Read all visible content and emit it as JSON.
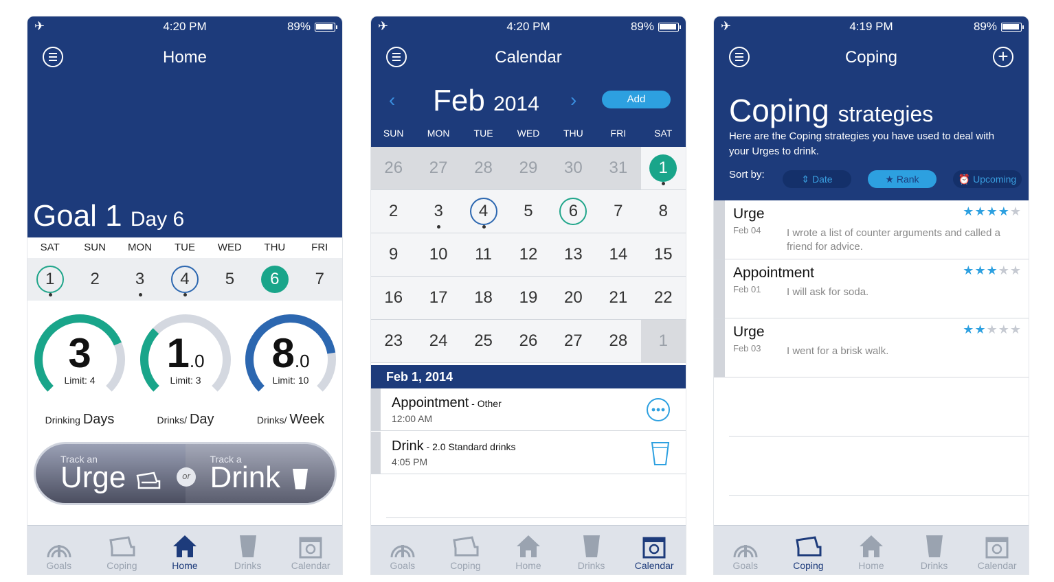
{
  "status": [
    {
      "time": "4:20 PM",
      "battery": "89%"
    },
    {
      "time": "4:20 PM",
      "battery": "89%"
    },
    {
      "time": "4:19 PM",
      "battery": "89%"
    }
  ],
  "tabs": [
    "Goals",
    "Coping",
    "Home",
    "Drinks",
    "Calendar"
  ],
  "home": {
    "title": "Home",
    "goal_main": "Goal 1",
    "goal_day": "Day 6",
    "week_days": [
      "SAT",
      "SUN",
      "MON",
      "TUE",
      "WED",
      "THU",
      "FRI"
    ],
    "week_dates": [
      "1",
      "2",
      "3",
      "4",
      "5",
      "6",
      "7"
    ],
    "gauges": [
      {
        "value": "3",
        "decimal": "",
        "limit": "Limit: 4",
        "label_small": "Drinking",
        "label_big": "Days",
        "fraction": 0.75,
        "color": "#19a58a"
      },
      {
        "value": "1",
        "decimal": ".0",
        "limit": "Limit: 3",
        "label_small": "Drinks/",
        "label_big": "Day",
        "fraction": 0.33,
        "color": "#19a58a"
      },
      {
        "value": "8",
        "decimal": ".0",
        "limit": "Limit: 10",
        "label_small": "Drinks/",
        "label_big": "Week",
        "fraction": 0.8,
        "color": "#2c67b0"
      }
    ],
    "track_urge_small": "Track an",
    "track_urge": "Urge",
    "or": "or",
    "track_drink_small": "Track a",
    "track_drink": "Drink"
  },
  "calendar": {
    "title": "Calendar",
    "month": "Feb",
    "year": "2014",
    "prev": "‹",
    "next": "›",
    "add": "Add",
    "weekdays": [
      "SUN",
      "MON",
      "TUE",
      "WED",
      "THU",
      "FRI",
      "SAT"
    ],
    "rows": [
      [
        "26",
        "27",
        "28",
        "29",
        "30",
        "31",
        "1"
      ],
      [
        "2",
        "3",
        "4",
        "5",
        "6",
        "7",
        "8"
      ],
      [
        "9",
        "10",
        "11",
        "12",
        "13",
        "14",
        "15"
      ],
      [
        "16",
        "17",
        "18",
        "19",
        "20",
        "21",
        "22"
      ],
      [
        "23",
        "24",
        "25",
        "26",
        "27",
        "28",
        "1"
      ]
    ],
    "selected_date": "Feb 1, 2014",
    "events": [
      {
        "title": "Appointment",
        "detail": " - Other",
        "time": "12:00 AM"
      },
      {
        "title": "Drink",
        "detail": " - 2.0 Standard drinks",
        "time": "4:05 PM"
      }
    ]
  },
  "coping": {
    "title": "Coping",
    "heading_main": "Coping",
    "heading_small": "strategies",
    "description": "Here are the Coping strategies you have used to deal with your Urges to drink.",
    "sort_by": "Sort by:",
    "sort_options": [
      "Date",
      "Rank",
      "Upcoming"
    ],
    "items": [
      {
        "type": "Urge",
        "date": "Feb 04",
        "text": "I wrote a list of counter arguments and called a friend for advice.",
        "rating": 4
      },
      {
        "type": "Appointment",
        "date": "Feb 01",
        "text": "I will ask for soda.",
        "rating": 3
      },
      {
        "type": "Urge",
        "date": "Feb 03",
        "text": "I went for a brisk walk.",
        "rating": 2
      }
    ]
  },
  "colors": {
    "navy": "#1d3b7b",
    "teal": "#19a58a",
    "blue": "#2da0e0"
  }
}
